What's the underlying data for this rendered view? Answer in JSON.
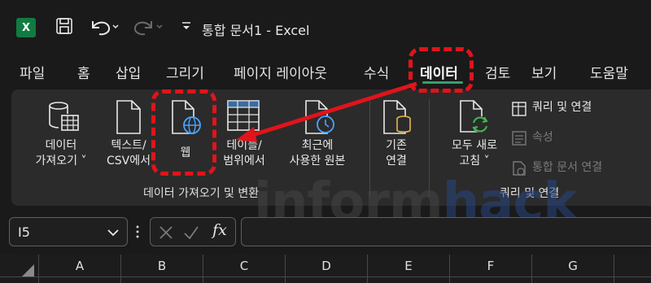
{
  "app": {
    "title": "통합 문서1 - Excel",
    "logo_letter": "X"
  },
  "tabs": [
    {
      "label": "파일"
    },
    {
      "label": "홈"
    },
    {
      "label": "삽입"
    },
    {
      "label": "그리기"
    },
    {
      "label": "페이지 레이아웃"
    },
    {
      "label": "수식"
    },
    {
      "label": "데이터",
      "active": true
    },
    {
      "label": "검토"
    },
    {
      "label": "보기"
    },
    {
      "label": "도움말"
    }
  ],
  "ribbon": {
    "get_data": {
      "line1": "데이터",
      "line2": "가져오기 ˅"
    },
    "text_csv": {
      "line1": "텍스트/",
      "line2": "CSV에서"
    },
    "web": {
      "line1": "웹"
    },
    "table_range": {
      "line1": "테이블/",
      "line2": "범위에서"
    },
    "recent_sources": {
      "line1": "최근에",
      "line2": "사용한 원본"
    },
    "existing_connections": {
      "line1": "기존",
      "line2": "연결"
    },
    "refresh_all": {
      "line1": "모두 새로",
      "line2": "고침 ˅"
    },
    "queries_connections": {
      "label": "쿼리 및 연결"
    },
    "properties": {
      "label": "속성",
      "disabled": true
    },
    "edit_links": {
      "label": "통합 문서 연결",
      "disabled": true
    },
    "group_get_transform": "데이터 가져오기 및 변환",
    "group_queries": "쿼리 및 연결"
  },
  "formula_bar": {
    "name_box": "I5",
    "formula": ""
  },
  "columns": [
    "A",
    "B",
    "C",
    "D",
    "E",
    "F",
    "G"
  ],
  "watermark": {
    "part1": "inform",
    "part2": "hack"
  },
  "colors": {
    "accent": "#2fa36b",
    "annotation": "#e0141b",
    "excel_green": "#107c41",
    "icon_blue": "#4aa3ff"
  }
}
